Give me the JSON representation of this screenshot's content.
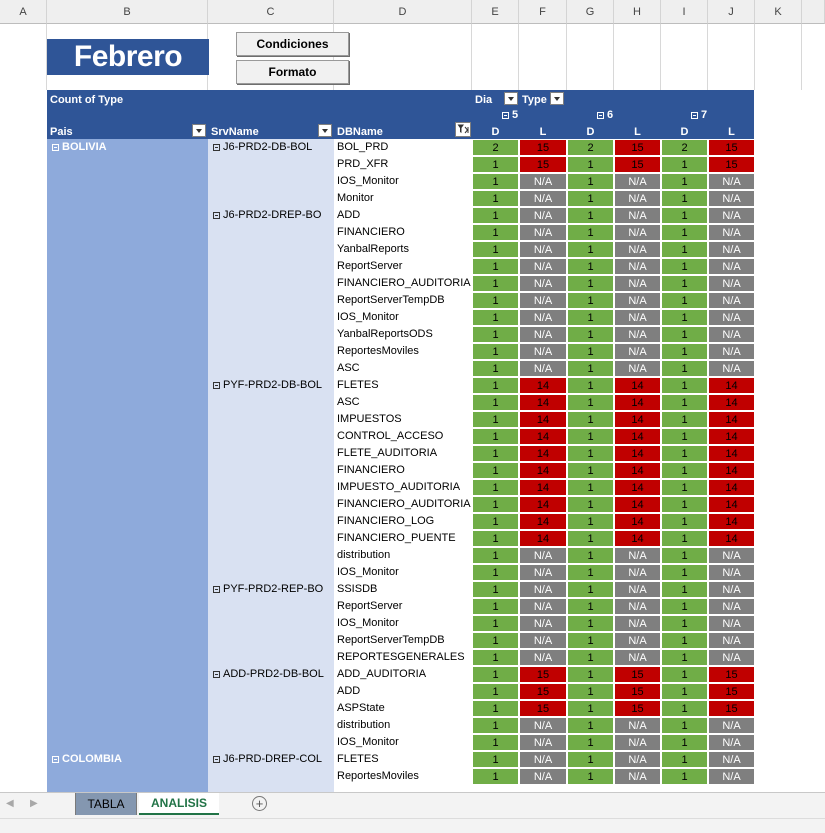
{
  "columns": [
    "A",
    "B",
    "C",
    "D",
    "E",
    "F",
    "G",
    "H",
    "I",
    "J",
    "K"
  ],
  "title": "Febrero",
  "buttons": {
    "condiciones": "Condiciones",
    "formato": "Formato"
  },
  "pivot": {
    "count_label": "Count of Type",
    "dia_label": "Dia",
    "type_label": "Type",
    "pais_header": "Pais",
    "srv_header": "SrvName",
    "db_header": "DBName",
    "days": [
      "5",
      "6",
      "7"
    ],
    "subcols": [
      "D",
      "L",
      "D",
      "L",
      "D",
      "L"
    ]
  },
  "countries": [
    {
      "name": "BOLIVIA",
      "row": 0
    },
    {
      "name": "COLOMBIA",
      "row": 36
    }
  ],
  "servers": [
    {
      "name": "J6-PRD2-DB-BOL",
      "row": 0
    },
    {
      "name": "J6-PRD2-DREP-BO",
      "row": 4
    },
    {
      "name": "PYF-PRD2-DB-BOL",
      "row": 14
    },
    {
      "name": "PYF-PRD2-REP-BO",
      "row": 26
    },
    {
      "name": "ADD-PRD2-DB-BOL",
      "row": 31
    },
    {
      "name": "J6-PRD-DREP-COL",
      "row": 36
    }
  ],
  "rows": [
    {
      "db": "BOL_PRD",
      "v": [
        "2",
        "15",
        "2",
        "15",
        "2",
        "15"
      ]
    },
    {
      "db": "PRD_XFR",
      "v": [
        "1",
        "15",
        "1",
        "15",
        "1",
        "15"
      ]
    },
    {
      "db": "IOS_Monitor",
      "v": [
        "1",
        "N/A",
        "1",
        "N/A",
        "1",
        "N/A"
      ]
    },
    {
      "db": "Monitor",
      "v": [
        "1",
        "N/A",
        "1",
        "N/A",
        "1",
        "N/A"
      ]
    },
    {
      "db": "ADD",
      "v": [
        "1",
        "N/A",
        "1",
        "N/A",
        "1",
        "N/A"
      ]
    },
    {
      "db": "FINANCIERO",
      "v": [
        "1",
        "N/A",
        "1",
        "N/A",
        "1",
        "N/A"
      ]
    },
    {
      "db": "YanbalReports",
      "v": [
        "1",
        "N/A",
        "1",
        "N/A",
        "1",
        "N/A"
      ]
    },
    {
      "db": "ReportServer",
      "v": [
        "1",
        "N/A",
        "1",
        "N/A",
        "1",
        "N/A"
      ]
    },
    {
      "db": "FINANCIERO_AUDITORIA",
      "v": [
        "1",
        "N/A",
        "1",
        "N/A",
        "1",
        "N/A"
      ]
    },
    {
      "db": "ReportServerTempDB",
      "v": [
        "1",
        "N/A",
        "1",
        "N/A",
        "1",
        "N/A"
      ]
    },
    {
      "db": "IOS_Monitor",
      "v": [
        "1",
        "N/A",
        "1",
        "N/A",
        "1",
        "N/A"
      ]
    },
    {
      "db": "YanbalReportsODS",
      "v": [
        "1",
        "N/A",
        "1",
        "N/A",
        "1",
        "N/A"
      ]
    },
    {
      "db": "ReportesMoviles",
      "v": [
        "1",
        "N/A",
        "1",
        "N/A",
        "1",
        "N/A"
      ]
    },
    {
      "db": "ASC",
      "v": [
        "1",
        "N/A",
        "1",
        "N/A",
        "1",
        "N/A"
      ]
    },
    {
      "db": "FLETES",
      "v": [
        "1",
        "14",
        "1",
        "14",
        "1",
        "14"
      ]
    },
    {
      "db": "ASC",
      "v": [
        "1",
        "14",
        "1",
        "14",
        "1",
        "14"
      ]
    },
    {
      "db": "IMPUESTOS",
      "v": [
        "1",
        "14",
        "1",
        "14",
        "1",
        "14"
      ]
    },
    {
      "db": "CONTROL_ACCESO",
      "v": [
        "1",
        "14",
        "1",
        "14",
        "1",
        "14"
      ]
    },
    {
      "db": "FLETE_AUDITORIA",
      "v": [
        "1",
        "14",
        "1",
        "14",
        "1",
        "14"
      ]
    },
    {
      "db": "FINANCIERO",
      "v": [
        "1",
        "14",
        "1",
        "14",
        "1",
        "14"
      ]
    },
    {
      "db": "IMPUESTO_AUDITORIA",
      "v": [
        "1",
        "14",
        "1",
        "14",
        "1",
        "14"
      ]
    },
    {
      "db": "FINANCIERO_AUDITORIA",
      "v": [
        "1",
        "14",
        "1",
        "14",
        "1",
        "14"
      ]
    },
    {
      "db": "FINANCIERO_LOG",
      "v": [
        "1",
        "14",
        "1",
        "14",
        "1",
        "14"
      ]
    },
    {
      "db": "FINANCIERO_PUENTE",
      "v": [
        "1",
        "14",
        "1",
        "14",
        "1",
        "14"
      ]
    },
    {
      "db": "distribution",
      "v": [
        "1",
        "N/A",
        "1",
        "N/A",
        "1",
        "N/A"
      ]
    },
    {
      "db": "IOS_Monitor",
      "v": [
        "1",
        "N/A",
        "1",
        "N/A",
        "1",
        "N/A"
      ]
    },
    {
      "db": "SSISDB",
      "v": [
        "1",
        "N/A",
        "1",
        "N/A",
        "1",
        "N/A"
      ]
    },
    {
      "db": "ReportServer",
      "v": [
        "1",
        "N/A",
        "1",
        "N/A",
        "1",
        "N/A"
      ]
    },
    {
      "db": "IOS_Monitor",
      "v": [
        "1",
        "N/A",
        "1",
        "N/A",
        "1",
        "N/A"
      ]
    },
    {
      "db": "ReportServerTempDB",
      "v": [
        "1",
        "N/A",
        "1",
        "N/A",
        "1",
        "N/A"
      ]
    },
    {
      "db": "REPORTESGENERALES",
      "v": [
        "1",
        "N/A",
        "1",
        "N/A",
        "1",
        "N/A"
      ]
    },
    {
      "db": "ADD_AUDITORIA",
      "v": [
        "1",
        "15",
        "1",
        "15",
        "1",
        "15"
      ]
    },
    {
      "db": "ADD",
      "v": [
        "1",
        "15",
        "1",
        "15",
        "1",
        "15"
      ]
    },
    {
      "db": "ASPState",
      "v": [
        "1",
        "15",
        "1",
        "15",
        "1",
        "15"
      ]
    },
    {
      "db": "distribution",
      "v": [
        "1",
        "N/A",
        "1",
        "N/A",
        "1",
        "N/A"
      ]
    },
    {
      "db": "IOS_Monitor",
      "v": [
        "1",
        "N/A",
        "1",
        "N/A",
        "1",
        "N/A"
      ]
    },
    {
      "db": "FLETES",
      "v": [
        "1",
        "N/A",
        "1",
        "N/A",
        "1",
        "N/A"
      ]
    },
    {
      "db": "ReportesMoviles",
      "v": [
        "1",
        "N/A",
        "1",
        "N/A",
        "1",
        "N/A"
      ]
    }
  ],
  "sheet_tabs": [
    "TABLA",
    "ANALISIS"
  ],
  "active_tab": "ANALISIS",
  "colors": {
    "header": "#2f5597",
    "pais": "#8eaadb",
    "server": "#d9e1f2",
    "green": "#70ad47",
    "red": "#c00000",
    "grey": "#7f7f7f",
    "tab_accent": "#217346"
  }
}
